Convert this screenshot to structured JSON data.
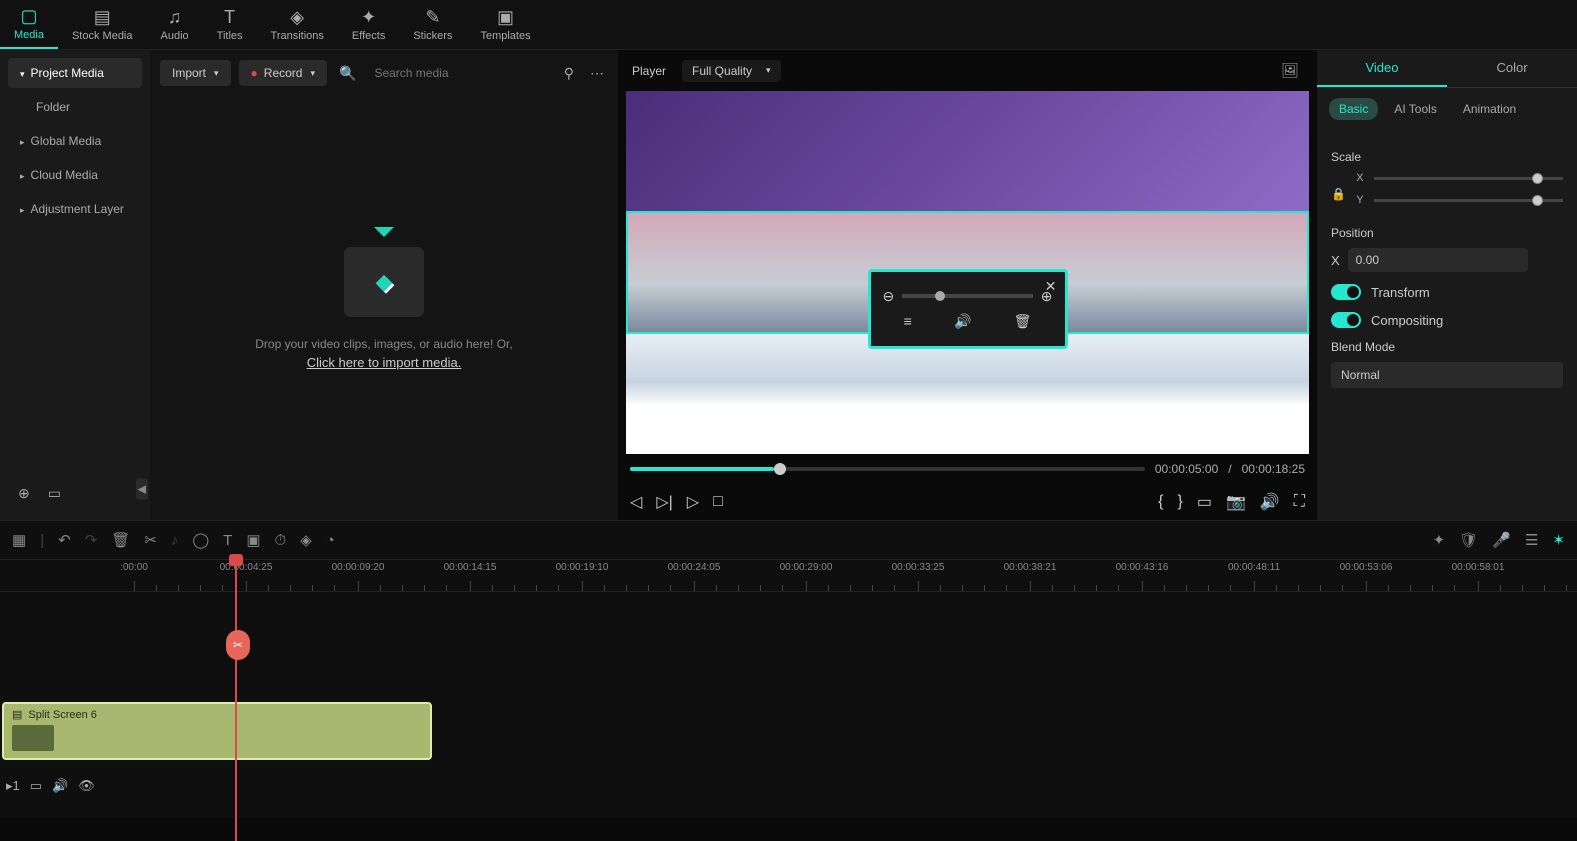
{
  "topnav": {
    "items": [
      {
        "label": "Media",
        "icon": "▢"
      },
      {
        "label": "Stock Media",
        "icon": "▤"
      },
      {
        "label": "Audio",
        "icon": "♫"
      },
      {
        "label": "Titles",
        "icon": "T"
      },
      {
        "label": "Transitions",
        "icon": "◈"
      },
      {
        "label": "Effects",
        "icon": "✦"
      },
      {
        "label": "Stickers",
        "icon": "✎"
      },
      {
        "label": "Templates",
        "icon": "▣"
      }
    ]
  },
  "sidebar": {
    "items": [
      {
        "label": "Project Media",
        "active": true
      },
      {
        "label": "Folder"
      },
      {
        "label": "Global Media"
      },
      {
        "label": "Cloud Media"
      },
      {
        "label": "Adjustment Layer"
      }
    ]
  },
  "media_toolbar": {
    "import": "Import",
    "record": "Record",
    "search_placeholder": "Search media"
  },
  "drop": {
    "text": "Drop your video clips, images, or audio here! Or,",
    "link": "Click here to import media."
  },
  "player": {
    "title": "Player",
    "quality": "Full Quality",
    "current_time": "00:00:05:00",
    "sep": "/",
    "total_time": "00:00:18:25"
  },
  "inspector": {
    "tabs": [
      "Video",
      "Color"
    ],
    "subtabs": [
      "Basic",
      "AI Tools",
      "Animation"
    ],
    "scale_label": "Scale",
    "x_label": "X",
    "y_label": "Y",
    "position_label": "Position",
    "position_x": "X",
    "position_x_val": "0.00",
    "transform": "Transform",
    "compositing": "Compositing",
    "blend_label": "Blend Mode",
    "blend_value": "Normal"
  },
  "timeline": {
    "times": [
      ":00:00",
      "00:00:04:25",
      "00:00:09:20",
      "00:00:14:15",
      "00:00:19:10",
      "00:00:24:05",
      "00:00:29:00",
      "00:00:33:25",
      "00:00:38:21",
      "00:00:43:16",
      "00:00:48:11",
      "00:00:53:06",
      "00:00:58:01"
    ],
    "clip_label": "Split Screen 6",
    "track_num": "1"
  }
}
